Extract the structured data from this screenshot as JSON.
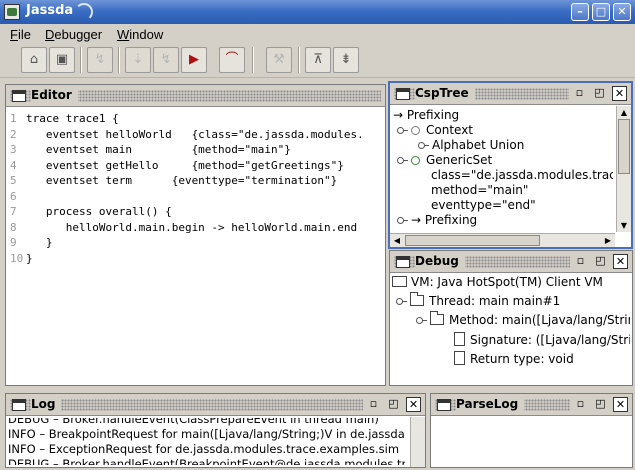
{
  "window": {
    "title": "Jassda",
    "controls": [
      "minimize-icon",
      "maximize-icon",
      "close-icon"
    ],
    "minimize_glyph": "–",
    "maximize_glyph": "□",
    "close_glyph": "✕"
  },
  "menu": {
    "file_first": "F",
    "file_rest": "ile",
    "debugger_first": "D",
    "debugger_rest": "ebugger",
    "window_first": "W",
    "window_rest": "indow"
  },
  "toolbar": {
    "buttons": [
      {
        "icon": "open-folder-icon",
        "glyph": "⌂",
        "enabled": true
      },
      {
        "icon": "save-icon",
        "glyph": "▣",
        "enabled": true
      },
      {
        "icon": "connect-icon",
        "glyph": "↯",
        "enabled": false
      },
      {
        "icon": "step-icon",
        "glyph": "⇣",
        "enabled": false
      },
      {
        "icon": "disconnect-icon",
        "glyph": "↯",
        "enabled": false
      },
      {
        "icon": "run-icon",
        "glyph": "▶",
        "enabled": true
      },
      {
        "icon": "step-over-icon",
        "glyph": "⌒",
        "enabled": true
      },
      {
        "icon": "wrench-icon",
        "glyph": "⚒",
        "enabled": false
      },
      {
        "icon": "collapse-icon",
        "glyph": "⊼",
        "enabled": true
      },
      {
        "icon": "expand-icon",
        "glyph": "⇟",
        "enabled": true
      }
    ]
  },
  "editor": {
    "title": "Editor",
    "lines": [
      {
        "num": "1",
        "text": "trace trace1 {"
      },
      {
        "num": "2",
        "text": "   eventset helloWorld   {class=\"de.jassda.modules."
      },
      {
        "num": "3",
        "text": "   eventset main         {method=\"main\"}"
      },
      {
        "num": "4",
        "text": "   eventset getHello     {method=\"getGreetings\"}"
      },
      {
        "num": "5",
        "text": "   eventset term      {eventtype=\"termination\"}"
      },
      {
        "num": "6",
        "text": ""
      },
      {
        "num": "7",
        "text": "   process overall() {"
      },
      {
        "num": "8",
        "text": "      helloWorld.main.begin -> helloWorld.main.end"
      },
      {
        "num": "9",
        "text": "   }"
      },
      {
        "num": "10",
        "text": "}"
      }
    ]
  },
  "csptree": {
    "title": "CspTree",
    "nodes": [
      {
        "text": "→ Prefixing"
      },
      {
        "text": "Context"
      },
      {
        "text": "Alphabet Union"
      },
      {
        "text": "GenericSet"
      },
      {
        "text": "class=\"de.jassda.modules.trace."
      },
      {
        "text": "method=\"main\""
      },
      {
        "text": "eventtype=\"end\""
      },
      {
        "text": "→ Prefixing"
      }
    ]
  },
  "debug": {
    "title": "Debug",
    "nodes": [
      {
        "text": "VM: Java HotSpot(TM) Client VM"
      },
      {
        "text": "Thread: main main#1"
      },
      {
        "text": "Method: main([Ljava/lang/Strin"
      },
      {
        "text": "Signature: ([Ljava/lang/Strin"
      },
      {
        "text": "Return type: void"
      }
    ]
  },
  "log": {
    "title": "Log",
    "lines": [
      "DEBUG – Broker.handleEvent(ClassPrepareEvent in thread main)",
      "INFO – BreakpointRequest for main([Ljava/lang/String;)V in de.jassda",
      "INFO – ExceptionRequest for de.jassda.modules.trace.examples.sim",
      "DEBUG – Broker.handleEvent(BreakpointEvent@de.jassda.modules.tr"
    ]
  },
  "parselog": {
    "title": "ParseLog"
  },
  "panel_controls": {
    "minimize_glyph": "▫",
    "maximize_glyph": "◰",
    "close_glyph": "✕"
  }
}
